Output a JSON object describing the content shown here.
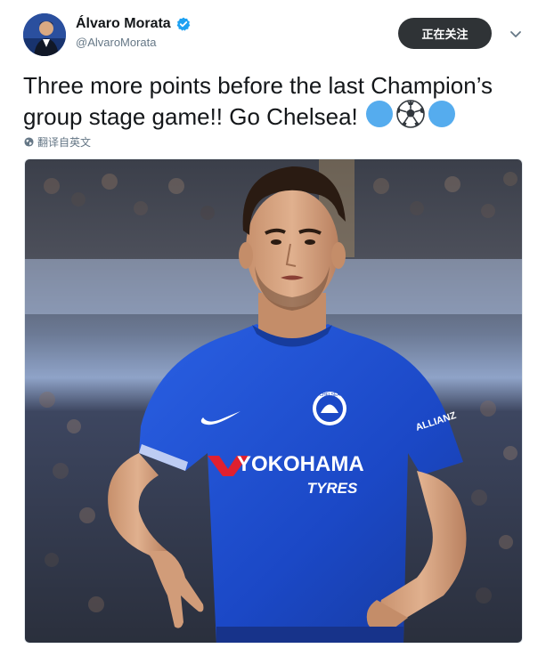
{
  "tweet": {
    "display_name": "Álvaro Morata",
    "handle": "@AlvaroMorata",
    "follow_label": "正在关注",
    "text": "Three more points before the last Champion’s group stage game!! Go Chelsea!",
    "translate_label": "翻译自英文",
    "emojis": [
      "blue-circle-icon",
      "soccer-ball-icon",
      "blue-circle-icon"
    ],
    "media": {
      "sponsor_line1": "YOKOHAMA",
      "sponsor_line2": "TYRES",
      "sleeve_text": "ALLIANZ",
      "crest_text": "CHELSEA"
    }
  },
  "colors": {
    "accent": "#1da1f2",
    "follow_button": "#2f3336",
    "kit_blue": "#1f4fd0",
    "emoji_blue": "#55acee"
  }
}
